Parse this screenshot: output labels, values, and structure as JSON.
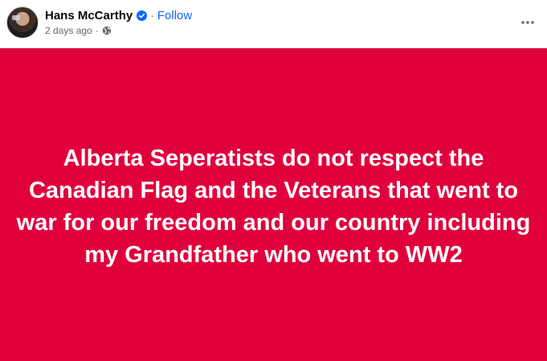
{
  "post": {
    "author": {
      "name": "Hans McCarthy",
      "verified": true
    },
    "follow_label": "Follow",
    "separator": "·",
    "timestamp": "2 days ago",
    "audience_icon": "globe-icon",
    "more_icon": "more-options-icon",
    "background_color": "#e0003c",
    "text": "Alberta Seperatists do not respect the Canadian Flag and the Veterans that went to war for our freedom and our country including my Grandfather who went to WW2"
  }
}
